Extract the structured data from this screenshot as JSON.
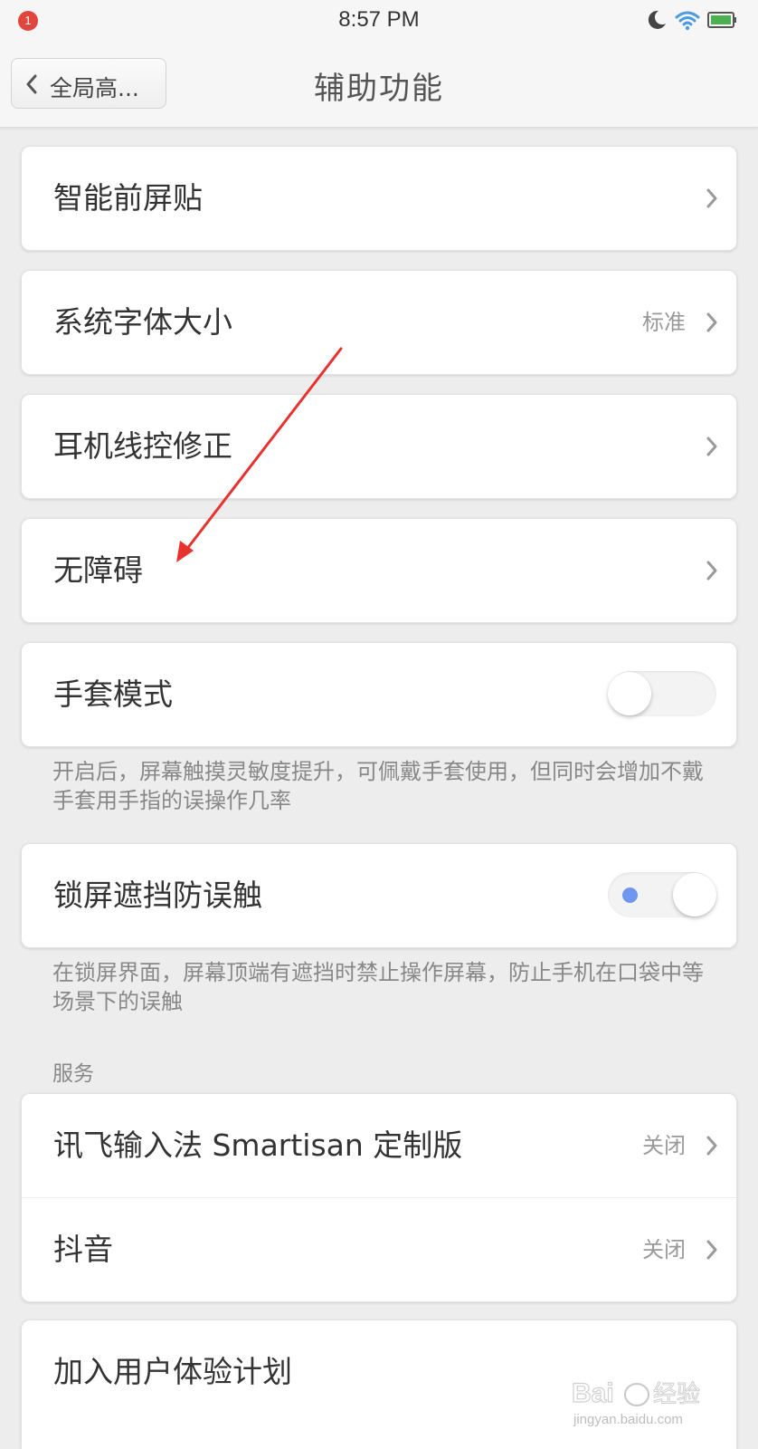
{
  "status_bar": {
    "notification_count": "1",
    "time": "8:57 PM",
    "icons": [
      "moon-icon",
      "wifi-icon",
      "battery-icon"
    ],
    "battery_color": "#4caf50"
  },
  "nav": {
    "back_label": "全局高...",
    "title": "辅助功能"
  },
  "items": {
    "smart_sidebar": {
      "label": "智能前屏贴"
    },
    "font_size": {
      "label": "系统字体大小",
      "value": "标准"
    },
    "headset_fix": {
      "label": "耳机线控修正"
    },
    "accessibility": {
      "label": "无障碍"
    },
    "glove_mode": {
      "label": "手套模式",
      "enabled": false,
      "description": "开启后，屏幕触摸灵敏度提升，可佩戴手套使用，但同时会增加不戴手套用手指的误操作几率"
    },
    "lockscreen_block": {
      "label": "锁屏遮挡防误触",
      "enabled": true,
      "description": "在锁屏界面，屏幕顶端有遮挡时禁止操作屏幕，防止手机在口袋中等场景下的误触"
    }
  },
  "services": {
    "header": "服务",
    "items": [
      {
        "label": "讯飞输入法 Smartisan 定制版",
        "value": "关闭"
      },
      {
        "label": "抖音",
        "value": "关闭"
      }
    ]
  },
  "experience_plan": {
    "label": "加入用户体验计划"
  },
  "watermark": {
    "text": "Bai 经验",
    "subtext": "jingyan.baidu.com"
  },
  "colors": {
    "accent": "#6f97f0",
    "annotation_arrow": "#e8322d",
    "badge": "#e2453c"
  }
}
